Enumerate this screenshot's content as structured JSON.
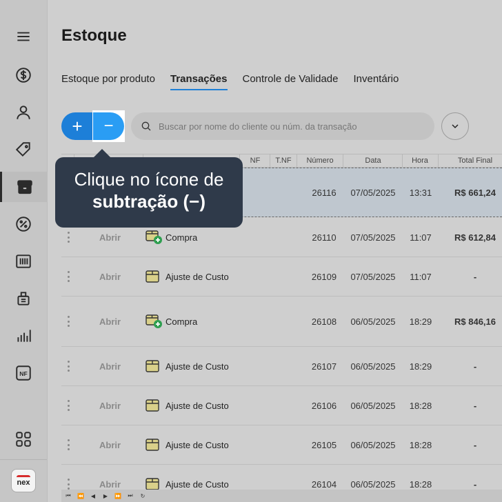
{
  "page": {
    "title": "Estoque"
  },
  "tabs": [
    {
      "label": "Estoque por produto"
    },
    {
      "label": "Transações"
    },
    {
      "label": "Controle de Validade"
    },
    {
      "label": "Inventário"
    }
  ],
  "toolbar": {
    "add_label": "+",
    "subtract_label": "−",
    "search_placeholder": "Buscar por nome do cliente ou núm. da transação"
  },
  "table": {
    "columns": [
      "NF",
      "T.NF",
      "Número",
      "Data",
      "Hora",
      "Total Final"
    ],
    "rows": [
      {
        "action": "",
        "type": "",
        "numero": "26116",
        "data": "07/05/2025",
        "hora": "13:31",
        "total": "R$ 661,24"
      },
      {
        "action": "Abrir",
        "type": "Compra",
        "numero": "26110",
        "data": "07/05/2025",
        "hora": "11:07",
        "total": "R$ 612,84"
      },
      {
        "action": "Abrir",
        "type": "Ajuste de Custo",
        "numero": "26109",
        "data": "07/05/2025",
        "hora": "11:07",
        "total": "-"
      },
      {
        "action": "Abrir",
        "type": "Compra",
        "numero": "26108",
        "data": "06/05/2025",
        "hora": "18:29",
        "total": "R$ 846,16"
      },
      {
        "action": "Abrir",
        "type": "Ajuste de Custo",
        "numero": "26107",
        "data": "06/05/2025",
        "hora": "18:29",
        "total": "-"
      },
      {
        "action": "Abrir",
        "type": "Ajuste de Custo",
        "numero": "26106",
        "data": "06/05/2025",
        "hora": "18:28",
        "total": "-"
      },
      {
        "action": "Abrir",
        "type": "Ajuste de Custo",
        "numero": "26105",
        "data": "06/05/2025",
        "hora": "18:28",
        "total": "-"
      },
      {
        "action": "Abrir",
        "type": "Ajuste de Custo",
        "numero": "26104",
        "data": "06/05/2025",
        "hora": "18:28",
        "total": "-"
      }
    ]
  },
  "tooltip": {
    "line1": "Clique no ícone de",
    "line2": "subtração (−)"
  },
  "sidebar": {
    "logo_text": "nex",
    "nf_label": "NF"
  },
  "pager": [
    "⏮",
    "⏪",
    "◀",
    "▶",
    "⏩",
    "⏭",
    "↻"
  ],
  "colors": {
    "accent": "#1d7fd8",
    "accent_light": "#2a9df4",
    "tooltip_bg": "#2f3a4a",
    "plus_badge": "#2e9e4f"
  }
}
